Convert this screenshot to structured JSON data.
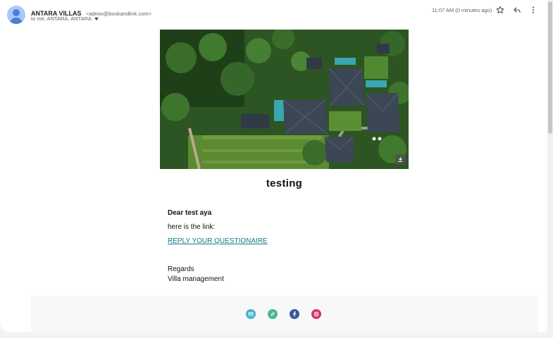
{
  "header": {
    "sender_name": "ANTARA VILLAS",
    "sender_email": "<admin@bookandlink.com>",
    "recipients": "to me, ANTARA, ANTARA",
    "timestamp": "11:07 AM (0 minutes ago)",
    "icons": [
      "star-icon",
      "reply-icon",
      "more-vert-icon"
    ]
  },
  "hero": {
    "image": "aerial-villa-photo",
    "download_icon": "download-icon"
  },
  "body": {
    "title": "testing",
    "greeting": "Dear test aya",
    "intro": "here is the link:",
    "link_text": "REPLY YOUR QUESTIONAIRE",
    "regards": "Regards",
    "signature": "Villa management"
  },
  "footer": {
    "social": [
      {
        "icon": "email-icon",
        "color": "#45b3c8"
      },
      {
        "icon": "link-icon",
        "color": "#4cb98a"
      },
      {
        "icon": "facebook-icon",
        "color": "#3b5998"
      },
      {
        "icon": "instagram-icon",
        "color": "#d6336c"
      }
    ]
  },
  "colors": {
    "link": "#127a8a",
    "avatar_bg": "#a8c7fa",
    "avatar_fg": "#4a7fd1"
  }
}
